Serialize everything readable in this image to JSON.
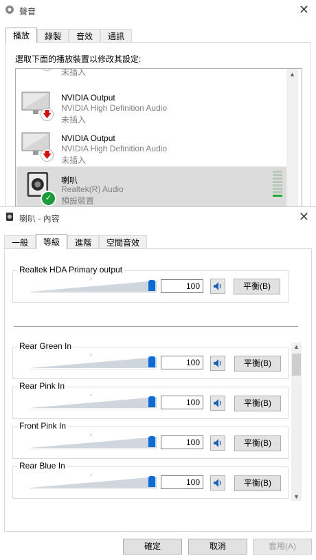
{
  "sound_window": {
    "title": "聲音",
    "tabs": [
      "播放",
      "錄製",
      "音效",
      "通訊"
    ],
    "active_tab": 0,
    "instruction": "選取下面的播放裝置以修改其設定:",
    "devices": [
      {
        "name": "",
        "description": "",
        "status": "未插入",
        "badge": "unplugged"
      },
      {
        "name": "NVIDIA Output",
        "description": "NVIDIA High Definition Audio",
        "status": "未插入",
        "badge": "unplugged"
      },
      {
        "name": "NVIDIA Output",
        "description": "NVIDIA High Definition Audio",
        "status": "未插入",
        "badge": "unplugged"
      },
      {
        "name": "喇叭",
        "description": "Realtek(R) Audio",
        "status": "預設裝置",
        "badge": "default",
        "selected": true
      }
    ]
  },
  "properties_window": {
    "title": "喇叭 - 內容",
    "tabs": [
      "一般",
      "等級",
      "進階",
      "空間音效"
    ],
    "active_tab": 1,
    "primary": {
      "label": "Realtek HDA Primary output",
      "level": 100,
      "balance_label": "平衡(B)"
    },
    "channels": [
      {
        "label": "Rear Green In",
        "level": 100,
        "balance_label": "平衡(B)"
      },
      {
        "label": "Rear Pink In",
        "level": 100,
        "balance_label": "平衡(B)"
      },
      {
        "label": "Front Pink In",
        "level": 100,
        "balance_label": "平衡(B)"
      },
      {
        "label": "Rear Blue In",
        "level": 100,
        "balance_label": "平衡(B)"
      }
    ],
    "buttons": {
      "ok": "確定",
      "cancel": "取消",
      "apply": "套用(A)"
    }
  },
  "icons": {
    "close": "close-icon",
    "speaker": "speaker-volume-icon",
    "unplugged": "down-arrow-badge-icon",
    "default": "check-badge-icon"
  },
  "colors": {
    "accent": "#0a6cd4",
    "selected_row": "#dcdcdc",
    "default_badge": "#1d9b3a",
    "unplugged_arrow": "#d01010"
  }
}
